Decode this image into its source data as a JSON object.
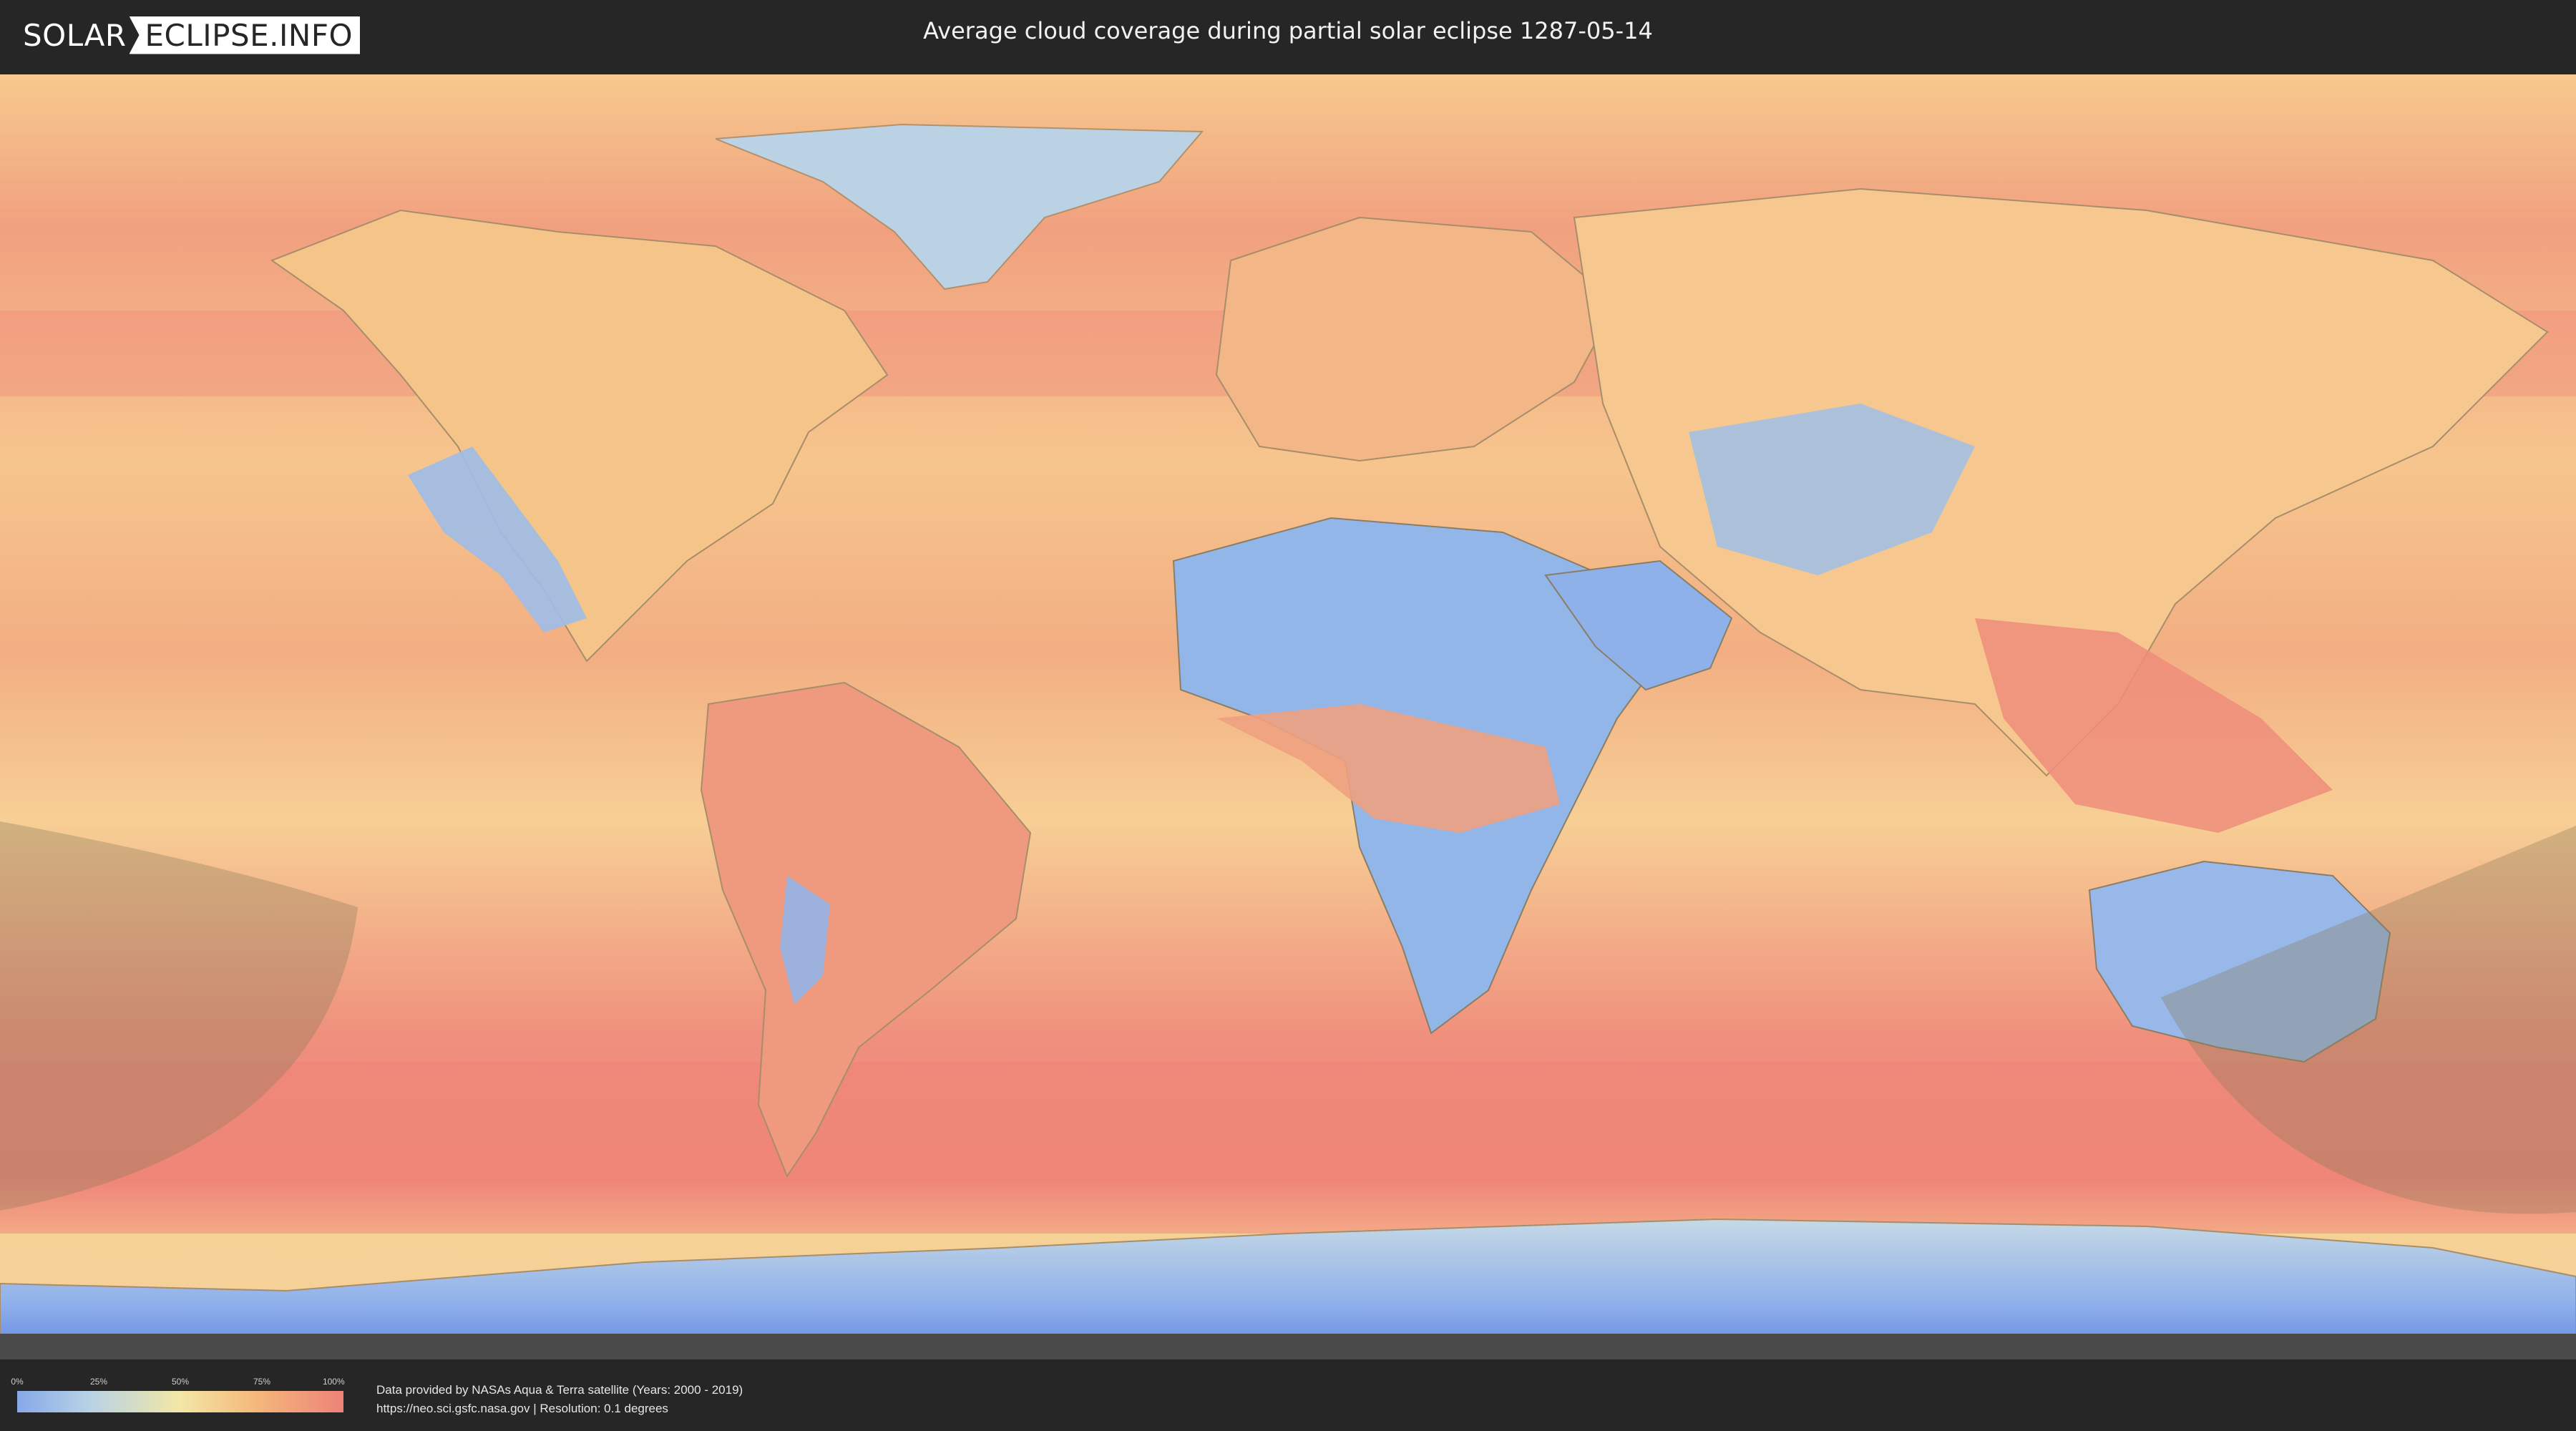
{
  "header": {
    "logo_left": "SOLAR",
    "logo_right": "ECLIPSE.INFO",
    "title": "Average cloud coverage during partial solar eclipse 1287-05-14"
  },
  "legend": {
    "ticks": [
      "0%",
      "25%",
      "50%",
      "75%",
      "100%"
    ],
    "tick_fractions": [
      0,
      0.25,
      0.5,
      0.75,
      1.0
    ],
    "colors": [
      "#87a9e8",
      "#b7d2e6",
      "#f3e7a6",
      "#f4b87b",
      "#ee8279"
    ]
  },
  "credits": {
    "line1": "Data provided by NASAs Aqua & Terra satellite (Years: 2000 - 2019)",
    "line2": "https://neo.sci.gsfc.nasa.gov | Resolution: 0.1 degrees"
  },
  "map": {
    "colors": {
      "ocean_cloudy": "#ee8d7c",
      "ocean_mid": "#f5c890",
      "land_clear": "#8fb2e8",
      "land_mid": "#c9dbe3",
      "eclipse_shadow": "#8a7a5a"
    }
  }
}
